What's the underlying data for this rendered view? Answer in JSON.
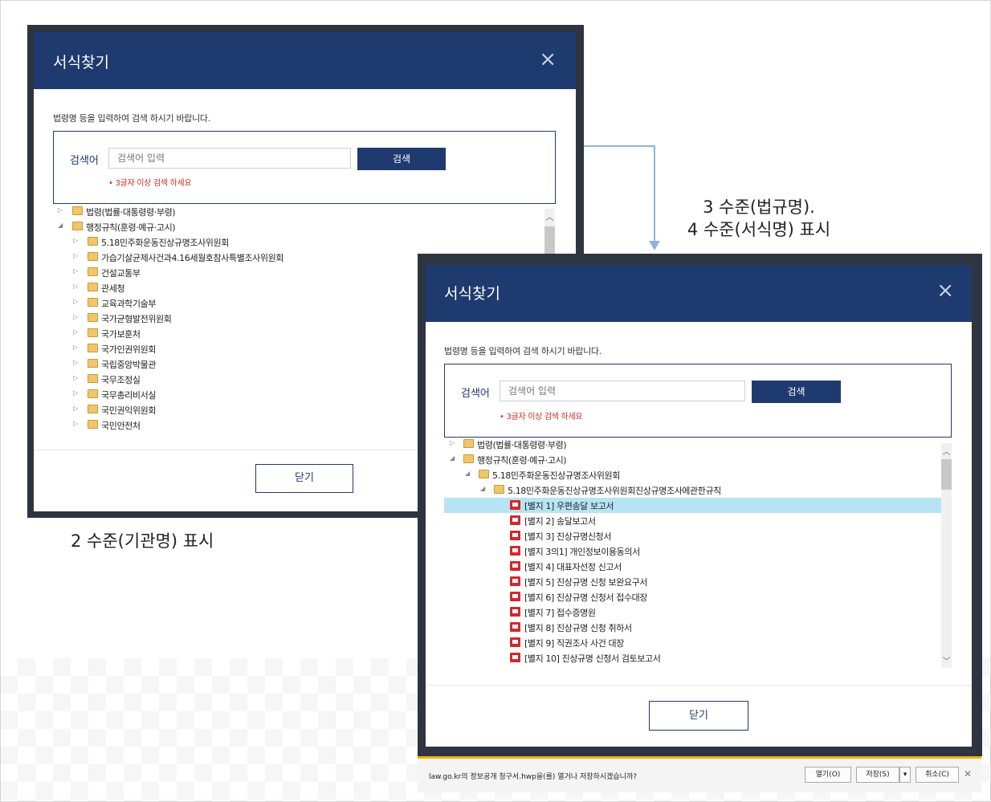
{
  "left_modal": {
    "title": "서식찾기",
    "close_icon": "close-icon",
    "description": "법령명 등을 입력하여 검색 하시기 바랍니다.",
    "search": {
      "label": "검색어",
      "placeholder": "검색어 입력",
      "button": "검색",
      "warning": "• 3글자 이상 검색 하세요"
    },
    "tree": [
      {
        "label": "법령(법률·대통령령·부령)",
        "expanded": false
      },
      {
        "label": "행정규칙(훈령·예규·고시)",
        "expanded": true
      },
      {
        "label": "5.18민주화운동진상규명조사위원회",
        "expanded": false
      },
      {
        "label": "가습기살균제사건과4.16세월호참사특별조사위원회",
        "expanded": false
      },
      {
        "label": "건설교통부",
        "expanded": false
      },
      {
        "label": "관세청",
        "expanded": false
      },
      {
        "label": "교육과학기술부",
        "expanded": false
      },
      {
        "label": "국가균형발전위원회",
        "expanded": false
      },
      {
        "label": "국가보훈처",
        "expanded": false
      },
      {
        "label": "국가인권위원회",
        "expanded": false
      },
      {
        "label": "국립중앙박물관",
        "expanded": false
      },
      {
        "label": "국무조정실",
        "expanded": false
      },
      {
        "label": "국무총리비서실",
        "expanded": false
      },
      {
        "label": "국민권익위원회",
        "expanded": false
      },
      {
        "label": "국민안전처",
        "expanded": false
      }
    ],
    "close_button": "닫기"
  },
  "right_modal": {
    "title": "서식찾기",
    "close_icon": "close-icon",
    "description": "법령명 등을 입력하여 검색 하시기 바랍니다.",
    "search": {
      "label": "검색어",
      "placeholder": "검색어 입력",
      "button": "검색",
      "warning": "• 3글자 이상 검색 하세요"
    },
    "tree": [
      {
        "label": "법령(법률·대통령령·부령)",
        "level": 0,
        "type": "folder",
        "expanded": false
      },
      {
        "label": "행정규칙(훈령·예규·고시)",
        "level": 0,
        "type": "folder",
        "expanded": true
      },
      {
        "label": "5.18민주화운동진상규명조사위원회",
        "level": 1,
        "type": "folder",
        "expanded": true
      },
      {
        "label": "5.18민주화운동진상규명조사위원회진상규명조사에관한규칙",
        "level": 2,
        "type": "folder",
        "expanded": true
      },
      {
        "label": "[별지 1] 우편송달 보고서",
        "level": 3,
        "type": "doc",
        "selected": true
      },
      {
        "label": "[별지 2] 송달보고서",
        "level": 3,
        "type": "doc"
      },
      {
        "label": "[별지 3] 진상규명신청서",
        "level": 3,
        "type": "doc"
      },
      {
        "label": "[별지 3의1] 개인정보이용동의서",
        "level": 3,
        "type": "doc"
      },
      {
        "label": "[별지 4] 대표자선정 신고서",
        "level": 3,
        "type": "doc"
      },
      {
        "label": "[별지 5] 진상규명 신청 보완요구서",
        "level": 3,
        "type": "doc"
      },
      {
        "label": "[별지 6] 진상규명 신청서 접수대장",
        "level": 3,
        "type": "doc"
      },
      {
        "label": "[별지 7] 접수증명원",
        "level": 3,
        "type": "doc"
      },
      {
        "label": "[별지 8] 진상규명 신청 취하서",
        "level": 3,
        "type": "doc"
      },
      {
        "label": "[별지 9] 직권조사 사건 대장",
        "level": 3,
        "type": "doc"
      },
      {
        "label": "[별지 10] 진상규명 신청서 검토보고서",
        "level": 3,
        "type": "doc"
      }
    ],
    "close_button": "닫기"
  },
  "captions": {
    "level2": "2 수준(기관명) 표시",
    "level34_line1": "3 수준(법규명).",
    "level34_line2": "4 수준(서식명) 표시"
  },
  "download_bar": {
    "message": "law.go.kr의 정보공개 청구서.hwp을(를) 열거나 저장하시겠습니까?",
    "open": "열기(O)",
    "save": "저장(S)",
    "save_menu": "▾",
    "cancel": "취소(C)",
    "close": "✕"
  },
  "colors": {
    "header": "#1f3a6f",
    "selected_row": "#b7e4f5",
    "warning": "#d9291c",
    "connector": "#8fb3df"
  }
}
